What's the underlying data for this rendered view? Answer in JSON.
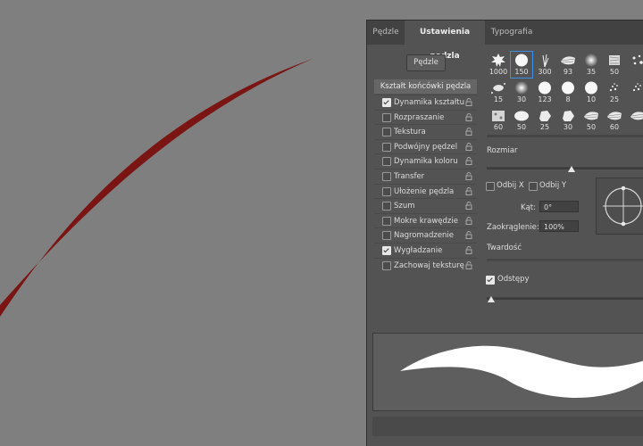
{
  "tabs": [
    {
      "label": "Pędzle",
      "active": false
    },
    {
      "label": "Ustawienia pędzla",
      "active": true
    },
    {
      "label": "Typografia",
      "active": false
    }
  ],
  "brushes_button": "Pędzle",
  "tip_shape_header": "Kształt końcówki pędzla",
  "options": [
    {
      "label": "Dynamika kształtu",
      "checked": true,
      "lock": true
    },
    {
      "label": "Rozpraszanie",
      "checked": false,
      "lock": true
    },
    {
      "label": "Tekstura",
      "checked": false,
      "lock": true
    },
    {
      "label": "Podwójny pędzel",
      "checked": false,
      "lock": true
    },
    {
      "label": "Dynamika koloru",
      "checked": false,
      "lock": true
    },
    {
      "label": "Transfer",
      "checked": false,
      "lock": true
    },
    {
      "label": "Ułożenie pędzla",
      "checked": false,
      "lock": true
    },
    {
      "label": "Szum",
      "checked": false,
      "lock": true
    },
    {
      "label": "Mokre krawędzie",
      "checked": false,
      "lock": true
    },
    {
      "label": "Nagromadzenie",
      "checked": false,
      "lock": true
    },
    {
      "label": "Wygładzanie",
      "checked": true,
      "lock": true
    },
    {
      "label": "Zachowaj teksturę",
      "checked": false,
      "lock": true
    }
  ],
  "brush_presets": [
    {
      "size": "1000",
      "shape": "leaf-icon"
    },
    {
      "size": "150",
      "shape": "hard-round-icon",
      "selected": true
    },
    {
      "size": "300",
      "shape": "grass-icon"
    },
    {
      "size": "93",
      "shape": "dry-brush-icon"
    },
    {
      "size": "35",
      "shape": "soft-round-icon"
    },
    {
      "size": "50",
      "shape": "chalk-icon"
    },
    {
      "size": "",
      "shape": "scatter-icon"
    },
    {
      "size": "15",
      "shape": "splatter-icon"
    },
    {
      "size": "30",
      "shape": "soft-round-icon"
    },
    {
      "size": "123",
      "shape": "hard-round-icon"
    },
    {
      "size": "8",
      "shape": "hard-round-icon"
    },
    {
      "size": "10",
      "shape": "hard-round-icon"
    },
    {
      "size": "25",
      "shape": "spray-icon"
    },
    {
      "size": "",
      "shape": "spray-icon"
    },
    {
      "size": "60",
      "shape": "texture-icon"
    },
    {
      "size": "50",
      "shape": "blob-icon"
    },
    {
      "size": "25",
      "shape": "rock-icon"
    },
    {
      "size": "30",
      "shape": "rock-icon"
    },
    {
      "size": "50",
      "shape": "dry-brush-icon"
    },
    {
      "size": "60",
      "shape": "dry-brush-icon"
    },
    {
      "size": "",
      "shape": "dry-brush-icon"
    }
  ],
  "size_label": "Rozmiar",
  "size_slider": 0.54,
  "flip_x_label": "Odbij X",
  "flip_x_checked": false,
  "flip_y_label": "Odbij Y",
  "flip_y_checked": false,
  "angle_label": "Kąt:",
  "angle_value": "0°",
  "roundness_label": "Zaokrąglenie:",
  "roundness_value": "100%",
  "hardness_label": "Twardość",
  "spacing_label": "Odstępy",
  "spacing_checked": true,
  "spacing_slider": 0.03,
  "colors": {
    "panel": "#535353",
    "tabbar": "#424242",
    "canvas": "#7f7f7f",
    "stroke": "#7a1513",
    "preview_bg": "#5e5e5e",
    "accent": "#3d8ee6"
  }
}
